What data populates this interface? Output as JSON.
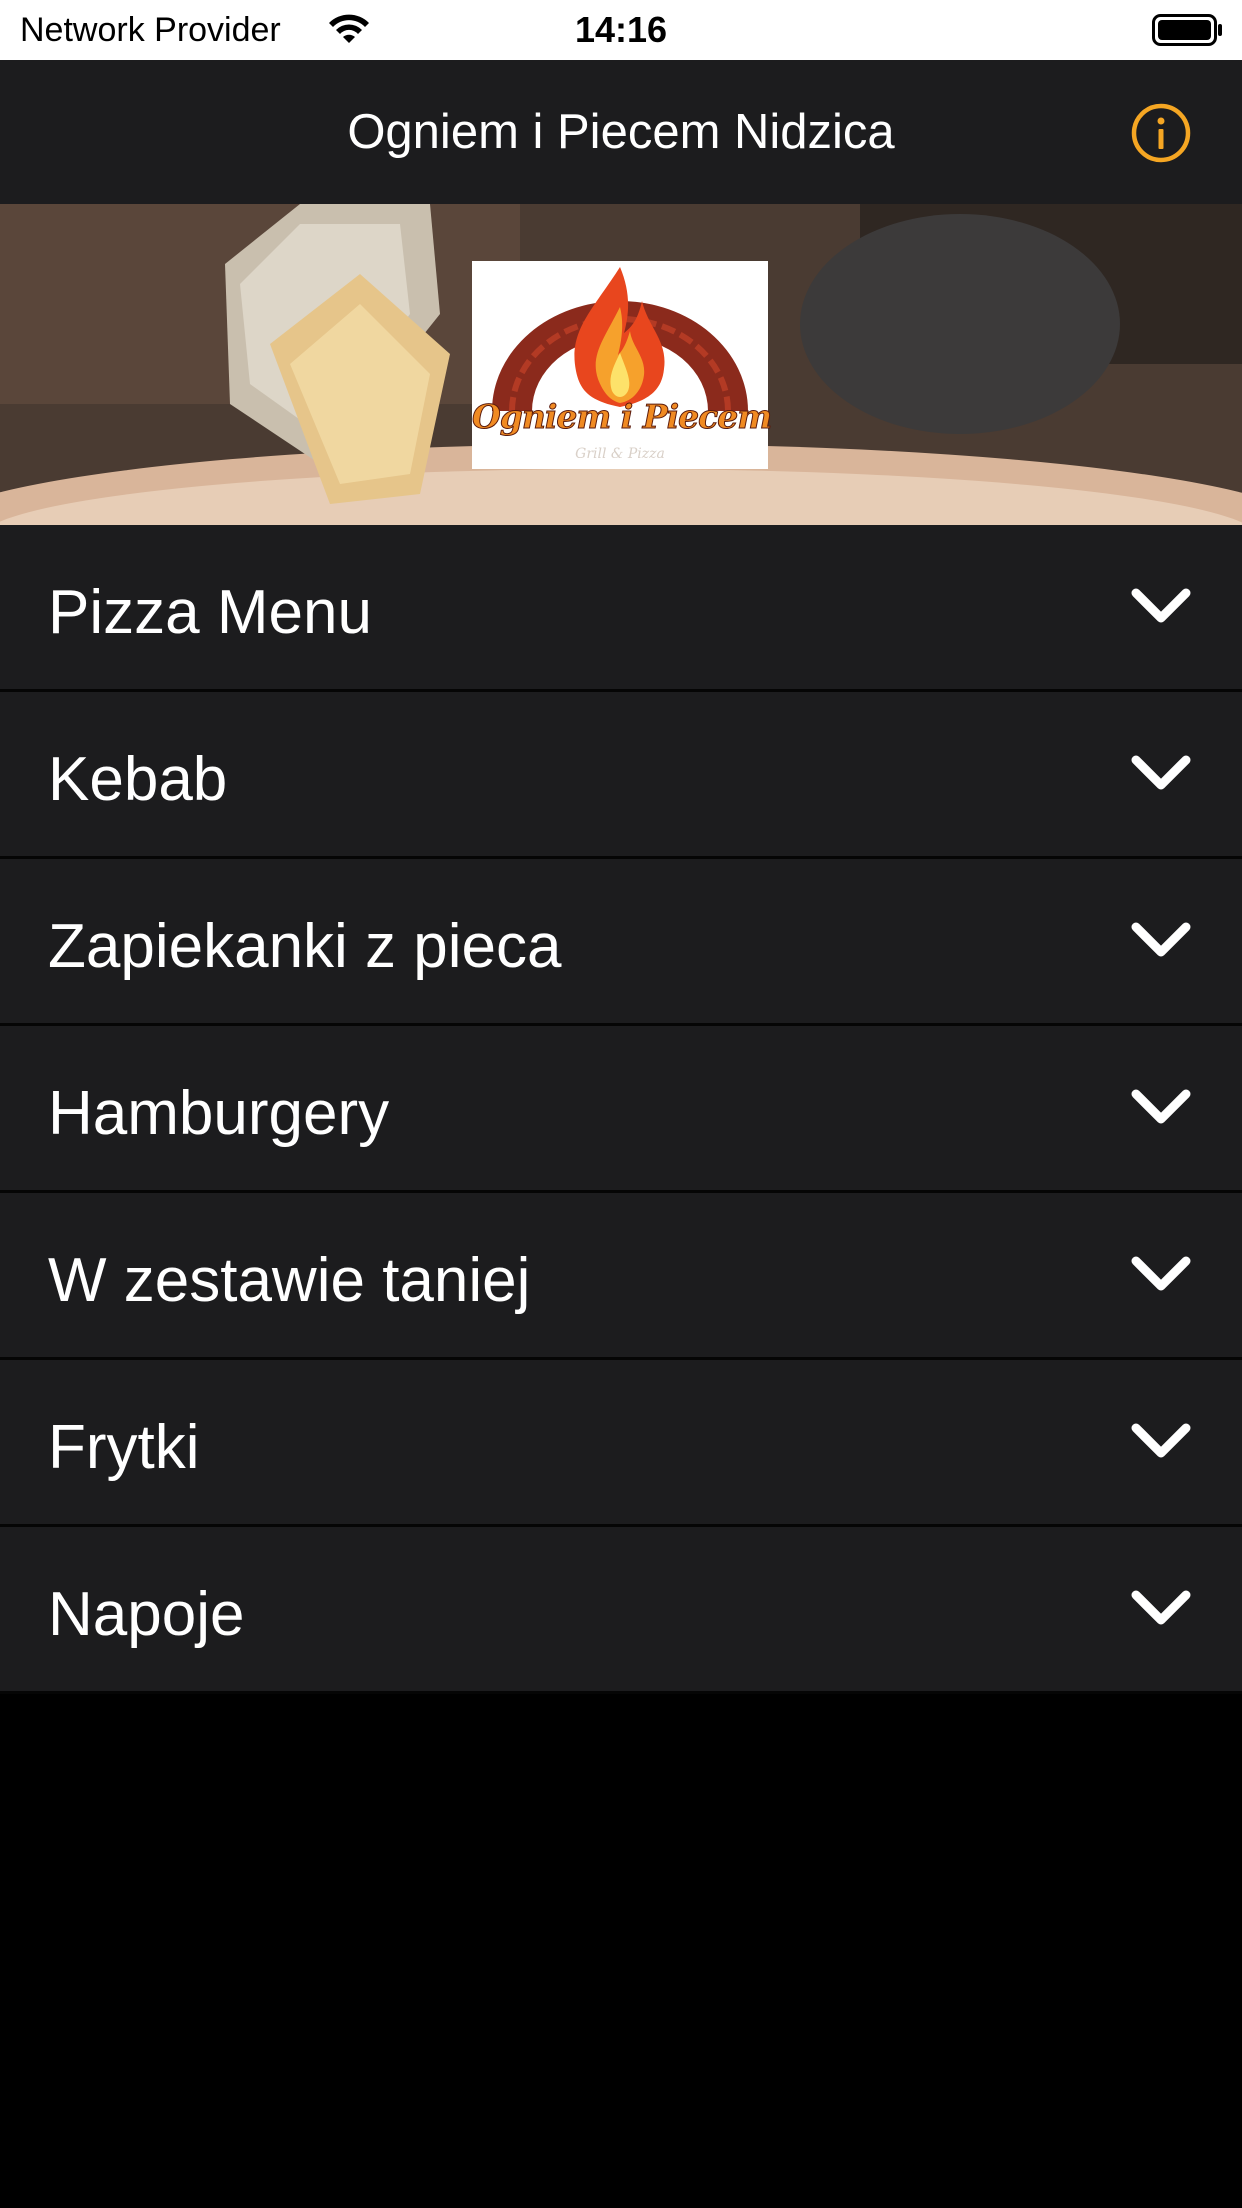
{
  "status_bar": {
    "provider": "Network Provider",
    "time": "14:16"
  },
  "nav": {
    "title": "Ogniem i Piecem Nidzica",
    "info_icon": "info-icon",
    "accent_color": "#f5a623"
  },
  "hero": {
    "logo_text": "Ogniem i Piecem",
    "logo_subtext": "Grill & Pizza"
  },
  "menu": {
    "items": [
      {
        "label": "Pizza Menu",
        "icon": "chevron-down-icon"
      },
      {
        "label": "Kebab",
        "icon": "chevron-down-icon"
      },
      {
        "label": "Zapiekanki z pieca",
        "icon": "chevron-down-icon"
      },
      {
        "label": "Hamburgery",
        "icon": "chevron-down-icon"
      },
      {
        "label": "W zestawie taniej",
        "icon": "chevron-down-icon"
      },
      {
        "label": "Frytki",
        "icon": "chevron-down-icon"
      },
      {
        "label": "Napoje",
        "icon": "chevron-down-icon"
      }
    ]
  },
  "colors": {
    "nav_background": "#1c1c1e",
    "row_background": "#1c1c1e",
    "page_background": "#000000",
    "text": "#ffffff"
  }
}
